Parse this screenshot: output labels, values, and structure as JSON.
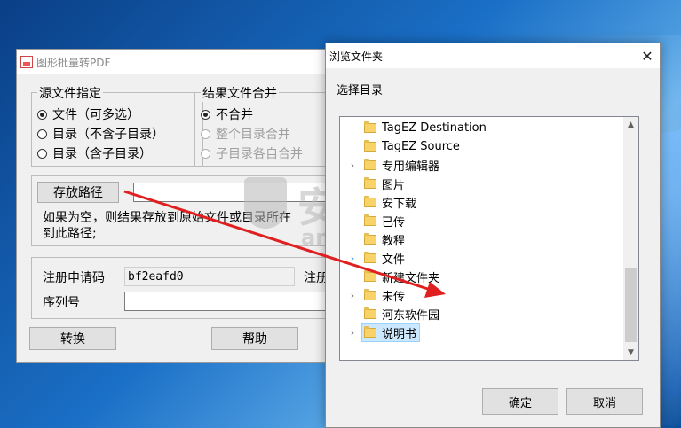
{
  "app": {
    "title": "图形批量转PDF",
    "source_group": {
      "legend": "源文件指定",
      "options": [
        "文件（可多选）",
        "目录（不含子目录）",
        "目录（含子目录）"
      ]
    },
    "merge_group": {
      "legend": "结果文件合并",
      "options": [
        "不合并",
        "整个目录合并",
        "子目录各自合并"
      ]
    },
    "save_path_button": "存放路径",
    "save_path_value": "",
    "hint_line1": "如果为空，则结果存放到原始文件或目录所在",
    "hint_line2": "到此路径;",
    "reg_code_label": "注册申请码",
    "reg_code_value": "bf2eafd0",
    "reg_label_right": "注册",
    "serial_label": "序列号",
    "serial_value": "",
    "convert_button": "转换",
    "help_button": "帮助"
  },
  "dialog": {
    "title": "浏览文件夹",
    "prompt": "选择目录",
    "folders": [
      {
        "name": "TagEZ Destination",
        "expander": ""
      },
      {
        "name": "TagEZ Source",
        "expander": ""
      },
      {
        "name": "专用编辑器",
        "expander": "›"
      },
      {
        "name": "图片",
        "expander": ""
      },
      {
        "name": "安下载",
        "expander": ""
      },
      {
        "name": "已传",
        "expander": ""
      },
      {
        "name": "教程",
        "expander": ""
      },
      {
        "name": "文件",
        "expander": "›"
      },
      {
        "name": "新建文件夹",
        "expander": ""
      },
      {
        "name": "未传",
        "expander": "›"
      },
      {
        "name": "河东软件园",
        "expander": ""
      },
      {
        "name": "说明书",
        "expander": "›"
      }
    ],
    "selected_index": 11,
    "ok_button": "确定",
    "cancel_button": "取消"
  },
  "watermark": {
    "main": "安下载",
    "sub": "anxz.com"
  },
  "colors": {
    "arrow": "#e02020",
    "selection": "#cce8ff"
  }
}
